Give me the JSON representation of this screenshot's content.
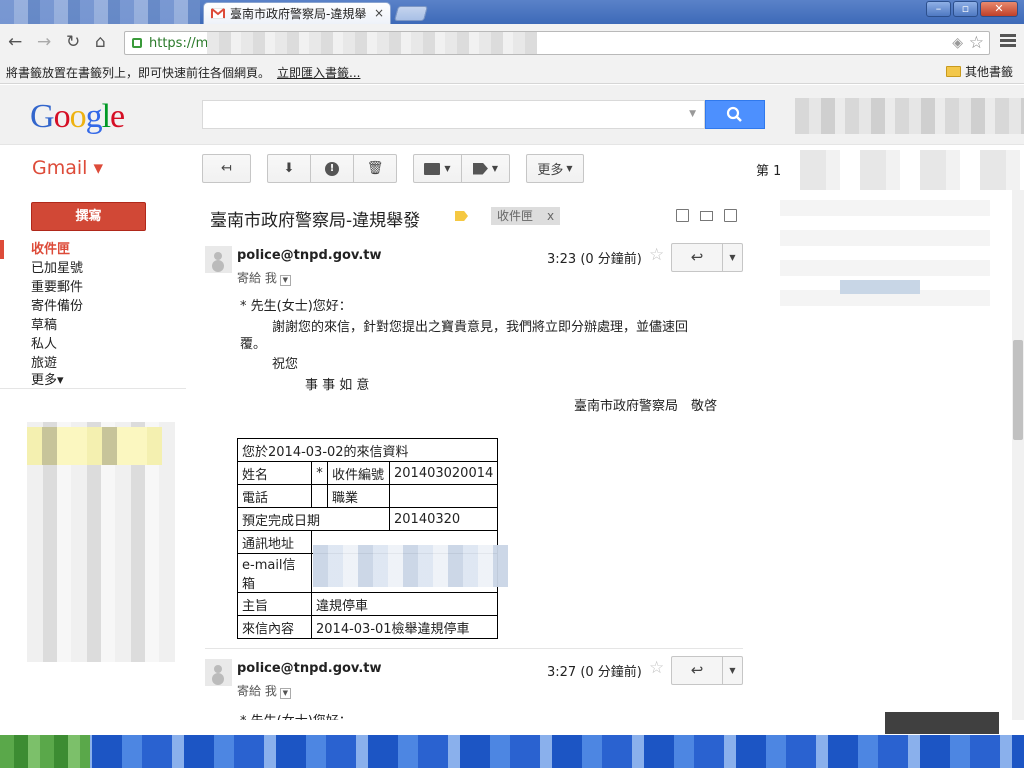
{
  "browser": {
    "tab_title": "臺南市政府警察局-違規舉",
    "tab_close": "×",
    "url_visible": "https://ma",
    "window_controls": [
      "–",
      "▫",
      "✕"
    ],
    "nav_icons": [
      "back-icon",
      "forward-icon",
      "reload-icon",
      "home-icon"
    ]
  },
  "bookmarks_bar": {
    "hint": "將書籤放置在書籤列上，即可快速前往各個網頁。",
    "import_link": "立即匯入書籤...",
    "other_bookmarks": "其他書籤"
  },
  "google": {
    "logo_letters": [
      {
        "ch": "G",
        "color": "#3366cc"
      },
      {
        "ch": "o",
        "color": "#d50f25"
      },
      {
        "ch": "o",
        "color": "#eeb211"
      },
      {
        "ch": "g",
        "color": "#3369e8"
      },
      {
        "ch": "l",
        "color": "#009925"
      },
      {
        "ch": "e",
        "color": "#d50f25"
      }
    ]
  },
  "gmail": {
    "label": "Gmail ▾",
    "more_button": "更多",
    "page_indicator": "第 1",
    "compose": "撰寫",
    "nav": [
      {
        "label": "收件匣",
        "active": true
      },
      {
        "label": "已加星號"
      },
      {
        "label": "重要郵件"
      },
      {
        "label": "寄件備份"
      },
      {
        "label": "草稿"
      },
      {
        "label": "私人"
      },
      {
        "label": "旅遊"
      },
      {
        "label": "更多▾"
      }
    ]
  },
  "conversation": {
    "subject": "臺南市政府警察局-違規舉發",
    "label_chip": "收件匣",
    "label_chip_close": "x",
    "messages": [
      {
        "sender": "police@tnpd.gov.tw",
        "to": "寄給 我",
        "time": "3:23 (0 分鐘前)"
      },
      {
        "sender": "police@tnpd.gov.tw",
        "to": "寄給 我",
        "time": "3:27 (0 分鐘前)",
        "preview_start": "* 先生(女士)您好："
      }
    ],
    "body": {
      "greeting": "* 先生(女士)您好：",
      "line1": "謝謝您的來信，針對您提出之寶貴意見，我們將立即分辦處理，並儘速回",
      "line2": "覆。",
      "closing1": "祝您",
      "closing2": "事 事 如 意",
      "signature": "臺南市政府警察局　敬啓"
    },
    "table": {
      "header": "您於2014-03-02的來信資料",
      "name_label": "姓名",
      "name_value": "*",
      "case_label": "收件編號",
      "case_value": "201403020014",
      "phone_label": "電話",
      "job_label": "職業",
      "due_label": "預定完成日期",
      "due_value": "20140320",
      "address_label": "通訊地址",
      "email_label": "e-mail信箱",
      "topic_label": "主旨",
      "topic_value": "違規停車",
      "content_label": "來信內容",
      "content_value": "2014-03-01檢舉違規停車"
    }
  }
}
